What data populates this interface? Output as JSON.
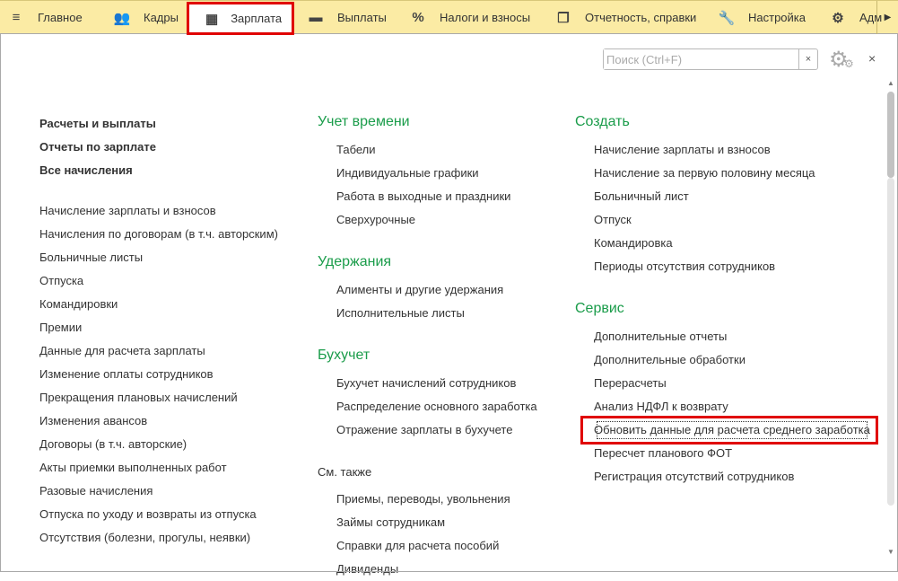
{
  "toolbar": {
    "tabs": [
      {
        "label": "Главное",
        "icon": "menu-icon",
        "glyph": "≡"
      },
      {
        "label": "Кадры",
        "icon": "users-icon",
        "glyph": "👥"
      },
      {
        "label": "Зарплата",
        "icon": "calculator-icon",
        "glyph": "▦",
        "active": true
      },
      {
        "label": "Выплаты",
        "icon": "card-icon",
        "glyph": "▬"
      },
      {
        "label": "Налоги и взносы",
        "icon": "percent-icon",
        "glyph": "%"
      },
      {
        "label": "Отчетность, справки",
        "icon": "documents-icon",
        "glyph": "❐"
      },
      {
        "label": "Настройка",
        "icon": "wrench-icon",
        "glyph": "🔧"
      },
      {
        "label": "Адм",
        "icon": "gear-icon",
        "glyph": "⚙"
      }
    ]
  },
  "search": {
    "placeholder": "Поиск (Ctrl+F)",
    "value": ""
  },
  "colors": {
    "heading": "#1a9c4a",
    "toolbar": "#fbeba4",
    "highlight": "#e00000"
  },
  "col1": {
    "bold": [
      "Расчеты и выплаты",
      "Отчеты по зарплате",
      "Все начисления"
    ],
    "items": [
      "Начисление зарплаты и взносов",
      "Начисления по договорам (в т.ч. авторским)",
      "Больничные листы",
      "Отпуска",
      "Командировки",
      "Премии",
      "Данные для расчета зарплаты",
      "Изменение оплаты сотрудников",
      "Прекращения плановых начислений",
      "Изменения авансов",
      "Договоры (в т.ч. авторские)",
      "Акты приемки выполненных работ",
      "Разовые начисления",
      "Отпуска по уходу и возвраты из отпуска",
      "Отсутствия (болезни, прогулы, неявки)"
    ]
  },
  "col2": [
    {
      "title": "Учет времени",
      "items": [
        "Табели",
        "Индивидуальные графики",
        "Работа в выходные и праздники",
        "Сверхурочные"
      ]
    },
    {
      "title": "Удержания",
      "items": [
        "Алименты и другие удержания",
        "Исполнительные листы"
      ]
    },
    {
      "title": "Бухучет",
      "items": [
        "Бухучет начислений сотрудников",
        "Распределение основного заработка",
        "Отражение зарплаты в бухучете"
      ]
    },
    {
      "title": "См. также",
      "plain": true,
      "items": [
        "Приемы, переводы, увольнения",
        "Займы сотрудникам",
        "Справки для расчета пособий",
        "Дивиденды"
      ]
    }
  ],
  "col3": [
    {
      "title": "Создать",
      "items": [
        "Начисление зарплаты и взносов",
        "Начисление за первую половину месяца",
        "Больничный лист",
        "Отпуск",
        "Командировка",
        "Периоды отсутствия сотрудников"
      ]
    },
    {
      "title": "Сервис",
      "items": [
        "Дополнительные отчеты",
        "Дополнительные обработки",
        "Перерасчеты",
        "Анализ НДФЛ к возврату",
        "Обновить данные для расчета среднего заработка",
        "Пересчет планового ФОТ",
        "Регистрация отсутствий сотрудников"
      ]
    }
  ],
  "highlighted_item": "Обновить данные для расчета среднего заработка"
}
